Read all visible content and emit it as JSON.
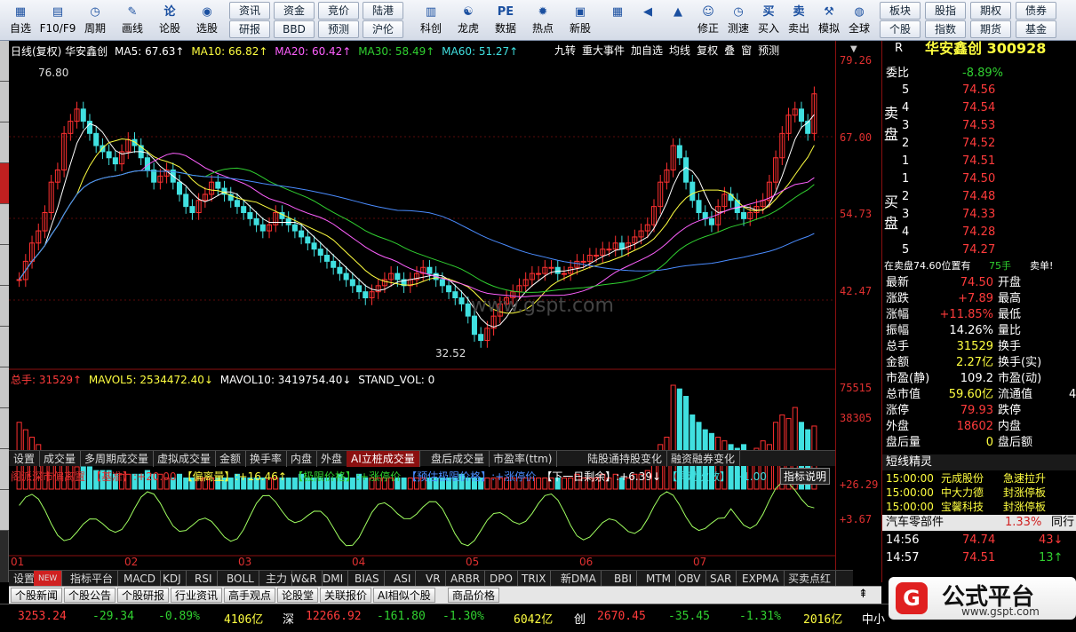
{
  "toolbar": {
    "items": [
      {
        "icon": "self-select-icon",
        "label": "自选",
        "glyph": "▦"
      },
      {
        "icon": "f10-icon",
        "label": "F10/F9",
        "glyph": "▤"
      },
      {
        "icon": "period-icon",
        "label": "周期",
        "glyph": "◷"
      },
      {
        "icon": "draw-icon",
        "label": "画线",
        "glyph": "✎"
      },
      {
        "icon": "stock-forum-icon",
        "label": "论股",
        "glyph": "论"
      },
      {
        "icon": "stock-pick-icon",
        "label": "选股",
        "glyph": "◉"
      }
    ],
    "small": [
      "资讯",
      "资金",
      "竞价",
      "陆港",
      "研报",
      "BBD",
      "预测",
      "沪伦"
    ],
    "items2": [
      {
        "icon": "tech-icon",
        "label": "科创",
        "glyph": "▥"
      },
      {
        "icon": "dragon-icon",
        "label": "龙虎",
        "glyph": "☯"
      },
      {
        "icon": "data-icon",
        "label": "数据",
        "glyph": "PE"
      },
      {
        "icon": "hot-icon",
        "label": "热点",
        "glyph": "✹"
      },
      {
        "icon": "new-stock-icon",
        "label": "新股",
        "glyph": "▣"
      }
    ],
    "items3": [
      {
        "icon": "layout-icon",
        "label": "",
        "glyph": "▦"
      },
      {
        "icon": "back-arrow-icon",
        "label": "",
        "glyph": "◀"
      },
      {
        "icon": "up-down-icon",
        "label": "",
        "glyph": "▲"
      },
      {
        "icon": "fix-icon",
        "label": "修正",
        "glyph": "☺"
      },
      {
        "icon": "test-icon",
        "label": "测速",
        "glyph": "◷"
      },
      {
        "icon": "buy-icon",
        "label": "买入",
        "glyph": "买"
      },
      {
        "icon": "sell-icon",
        "label": "卖出",
        "glyph": "卖"
      },
      {
        "icon": "simulate-icon",
        "label": "模拟",
        "glyph": "⚒"
      },
      {
        "icon": "globe-icon",
        "label": "全球",
        "glyph": "◍"
      }
    ],
    "right_small": [
      "板块",
      "股指",
      "期权",
      "债券",
      "个股",
      "指数",
      "期货",
      "基金"
    ]
  },
  "chart": {
    "header": "日线(复权)  华安鑫创",
    "ma5": "MA5: 67.63↑",
    "ma10": "MA10: 66.82↑",
    "ma20": "MA20: 60.42↑",
    "ma30": "MA30: 58.49↑",
    "ma60": "MA60: 51.27↑",
    "top_menu": [
      "九转",
      "重大事件",
      "加自选",
      "均线",
      "复权",
      "叠",
      "窗",
      "预测"
    ],
    "high_label": "76.80",
    "low_label": "32.52",
    "watermark": "www.gspt.com",
    "axis": [
      "79.26",
      "67.00",
      "54.73",
      "42.47"
    ],
    "vol_axis": [
      "75515",
      "38305"
    ],
    "ind_axis": [
      "+26.29",
      "+3.67"
    ],
    "vol_header": {
      "total": "总手: 31529↑",
      "mavol5": "MAVOL5: 2534472.40↓",
      "mavol10": "MAVOL10: 3419754.40↓",
      "std": "STAND_VOL: 0"
    },
    "ind_header": [
      "阁派深市偏离置",
      "【基准】:+20.00",
      "【偏离量】:+16.46↑",
      "【极限价格】:+涨停价",
      "【预估极限价格】:+涨停价",
      "【下一日剩余】:+6.39↓",
      "【异动次数】:+1.00"
    ],
    "ind_btn": "指标说明",
    "months": [
      "01",
      "02",
      "03",
      "04",
      "05",
      "06",
      "07"
    ]
  },
  "tabs": [
    "设置",
    "成交量",
    "多周期成交量",
    "虚拟成交量",
    "金额",
    "换手率",
    "内盘",
    "外盘",
    "AI立桩成交量",
    "盘后成交量",
    "市盈率(ttm)",
    "陆股通持股变化",
    "融资融券变化"
  ],
  "ind_tabs": [
    "设置",
    "NEW",
    "指标平台",
    "MACD",
    "KDJ",
    "RSI",
    "BOLL",
    "主力",
    "W&R",
    "DMI",
    "BIAS",
    "ASI",
    "VR",
    "ARBR",
    "DPO",
    "TRIX",
    "新DMA",
    "BBI",
    "MTM",
    "OBV",
    "SAR",
    "EXPMA",
    "买卖点红"
  ],
  "news_tabs": [
    "个股新闻",
    "个股公告",
    "个股研报",
    "行业资讯",
    "高手观点",
    "论股堂",
    "关联报价",
    "AI相似个股",
    "商品价格"
  ],
  "quote": {
    "title": "华安鑫创 300928",
    "r": "R",
    "weibi_label": "委比",
    "weibi": "-8.89%",
    "sell": [
      [
        "5",
        "74.56"
      ],
      [
        "4",
        "74.54"
      ],
      [
        "3",
        "74.53"
      ],
      [
        "2",
        "74.52"
      ],
      [
        "1",
        "74.51"
      ]
    ],
    "buy": [
      [
        "1",
        "74.50"
      ],
      [
        "2",
        "74.48"
      ],
      [
        "3",
        "74.33"
      ],
      [
        "4",
        "74.28"
      ],
      [
        "5",
        "74.27"
      ]
    ],
    "sell_label": "卖盘",
    "buy_label": "买盘",
    "notice": "在卖盘74.60位置有",
    "notice_vol": "75手",
    "notice_tag": "卖单!",
    "stats": [
      [
        "最新",
        "74.50",
        "red",
        "开盘",
        ""
      ],
      [
        "涨跌",
        "+7.89",
        "red",
        "最高",
        ""
      ],
      [
        "涨幅",
        "+11.85%",
        "red",
        "最低",
        ""
      ],
      [
        "振幅",
        "14.26%",
        "wht",
        "量比",
        ""
      ],
      [
        "总手",
        "31529",
        "yel",
        "换手",
        ""
      ],
      [
        "金额",
        "2.27亿",
        "yel",
        "换手(实)",
        ""
      ],
      [
        "市盈(静)",
        "109.2",
        "wht",
        "市盈(动)",
        ""
      ],
      [
        "总市值",
        "59.60亿",
        "yel",
        "流通值",
        "4"
      ],
      [
        "涨停",
        "79.93",
        "red",
        "跌停",
        ""
      ],
      [
        "外盘",
        "18602",
        "red",
        "内盘",
        ""
      ],
      [
        "盘后量",
        "0",
        "yel",
        "盘后额",
        ""
      ]
    ],
    "alert_title": "短线精灵",
    "alerts": [
      [
        "15:00:00",
        "元成股份",
        "急速拉升"
      ],
      [
        "15:00:00",
        "中大力德",
        "封涨停板"
      ],
      [
        "15:00:00",
        "宝馨科技",
        "封涨停板"
      ]
    ],
    "sector": "汽车零部件",
    "sector_pct": "1.33%",
    "sector_tag": "同行",
    "ticks": [
      [
        "14:56",
        "74.74",
        "43"
      ],
      [
        "14:57",
        "74.51",
        "13"
      ]
    ]
  },
  "status": {
    "sh": "3253.24",
    "sh_chg": "-29.34",
    "sh_pct": "-0.89%",
    "sh_amt": "4106亿",
    "sz_label": "深",
    "sz": "12266.92",
    "sz_chg": "-161.80",
    "sz_pct": "-1.30%",
    "sz_amt": "6042亿",
    "cy_label": "创",
    "cy": "2670.45",
    "cy_chg": "-35.45",
    "cy_pct": "-1.31%",
    "cy_amt": "2016亿",
    "extra": "中小"
  },
  "logo": {
    "text": "公式平台",
    "url": "www.gspt.com"
  },
  "chart_data": {
    "type": "candlestick",
    "title": "华安鑫创 日线(复权)",
    "ohlc_approx": {
      "start": [
        38,
        40,
        37,
        39
      ],
      "peak1": 76.8,
      "trough": 32.52,
      "last": 74.5
    },
    "close_series": [
      44,
      47,
      50,
      52,
      55,
      60,
      62,
      68,
      70,
      72,
      70,
      68,
      66,
      65,
      64,
      63,
      65,
      67,
      66,
      64,
      62,
      60,
      61,
      62,
      60,
      58,
      56,
      55,
      57,
      58,
      60,
      59,
      58,
      57,
      56,
      55,
      54,
      53,
      52,
      53,
      55,
      54,
      53,
      52,
      51,
      50,
      49,
      48,
      47,
      46,
      45,
      44,
      43,
      42,
      41,
      42,
      43,
      44,
      45,
      44,
      43,
      44,
      45,
      46,
      45,
      44,
      43,
      42,
      41,
      40,
      38,
      35,
      34,
      36,
      38,
      40,
      41,
      42,
      43,
      44,
      45,
      45,
      46,
      46,
      45,
      45,
      46,
      47,
      47,
      48,
      48,
      49,
      49,
      50,
      49,
      50,
      51,
      52,
      53,
      56,
      60,
      62,
      66,
      64,
      60,
      57,
      55,
      54,
      53,
      56,
      58,
      57,
      55,
      54,
      55,
      56,
      57,
      60,
      64,
      68,
      71,
      72,
      70,
      68,
      74.5
    ],
    "volumes": [
      18,
      16,
      14,
      12,
      10,
      9,
      8,
      7,
      7,
      6,
      6,
      6,
      5,
      5,
      5,
      4,
      4,
      4,
      4,
      4,
      5,
      4,
      4,
      3,
      3,
      4,
      3,
      3,
      3,
      3,
      3,
      3,
      3,
      3,
      4,
      3,
      3,
      3,
      3,
      3,
      3,
      3,
      3,
      3,
      4,
      3,
      3,
      3,
      3,
      3,
      4,
      3,
      3,
      4,
      3,
      3,
      3,
      3,
      3,
      3,
      3,
      3,
      3,
      3,
      3,
      3,
      3,
      3,
      3,
      4,
      3,
      3,
      3,
      3,
      3,
      3,
      3,
      3,
      3,
      3,
      3,
      3,
      3,
      3,
      3,
      3,
      3,
      4,
      3,
      3,
      3,
      4,
      3,
      4,
      3,
      3,
      4,
      4,
      5,
      8,
      12,
      14,
      28,
      27,
      25,
      20,
      18,
      16,
      15,
      14,
      13,
      12,
      11,
      12,
      10,
      11,
      13,
      12,
      18,
      20,
      19,
      22,
      18,
      16,
      17,
      15,
      14,
      12,
      14
    ]
  }
}
